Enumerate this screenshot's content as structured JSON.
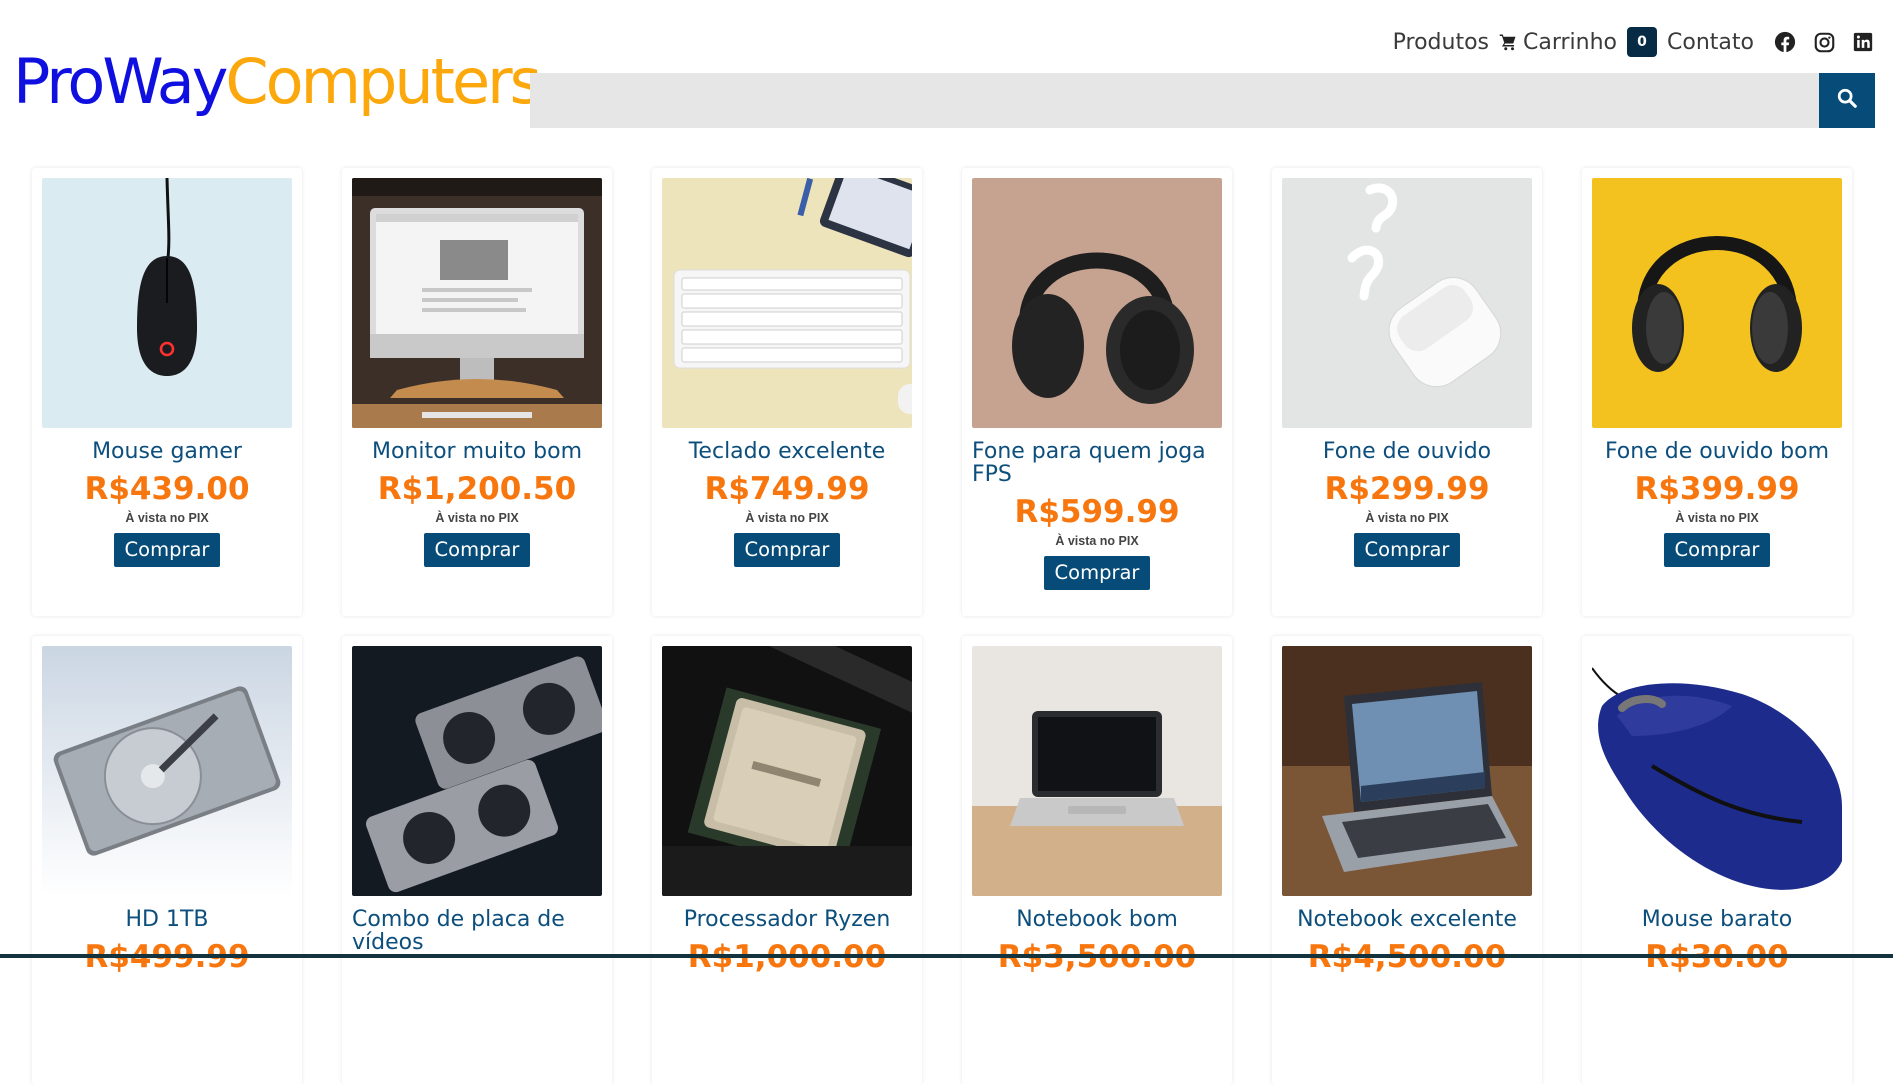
{
  "brand": {
    "part1": "ProWay",
    "part2": "Computers"
  },
  "nav": {
    "products": "Produtos",
    "cart": "Carrinho",
    "cart_count": "0",
    "contact": "Contato",
    "social_icons": [
      "facebook-icon",
      "instagram-icon",
      "linkedin-icon"
    ]
  },
  "search": {
    "placeholder": "",
    "value": "",
    "button_icon": "search-icon"
  },
  "colors": {
    "brand_blue": "#0f0fe0",
    "brand_orange": "#fca70b",
    "accent": "#074c78",
    "price": "#f7760e"
  },
  "products": [
    {
      "name": "Mouse gamer",
      "price": "R$439.00",
      "note": "À vista no PIX",
      "buy": "Comprar"
    },
    {
      "name": "Monitor muito bom",
      "price": "R$1,200.50",
      "note": "À vista no PIX",
      "buy": "Comprar"
    },
    {
      "name": "Teclado excelente",
      "price": "R$749.99",
      "note": "À vista no PIX",
      "buy": "Comprar"
    },
    {
      "name": "Fone para quem joga FPS",
      "price": "R$599.99",
      "note": "À vista no PIX",
      "buy": "Comprar"
    },
    {
      "name": "Fone de ouvido",
      "price": "R$299.99",
      "note": "À vista no PIX",
      "buy": "Comprar"
    },
    {
      "name": "Fone de ouvido bom",
      "price": "R$399.99",
      "note": "À vista no PIX",
      "buy": "Comprar"
    },
    {
      "name": "HD 1TB",
      "price": "R$499.99"
    },
    {
      "name": "Combo de placa de vídeos",
      "price": ""
    },
    {
      "name": "Processador Ryzen",
      "price": "R$1,000.00"
    },
    {
      "name": "Notebook bom",
      "price": "R$3,500.00"
    },
    {
      "name": "Notebook excelente",
      "price": "R$4,500.00"
    },
    {
      "name": "Mouse barato",
      "price": "R$30.00"
    }
  ]
}
